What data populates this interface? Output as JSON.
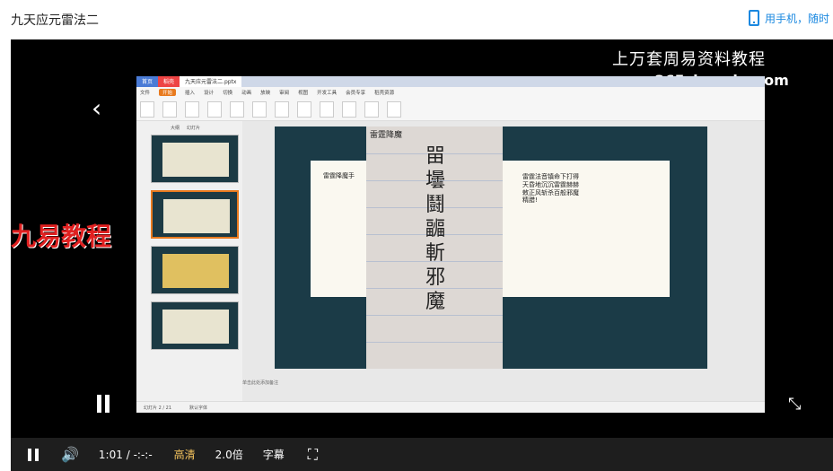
{
  "page": {
    "title": "九天应元雷法二",
    "phone_link": "用手机，随时"
  },
  "player": {
    "overlay_line1": "上万套周易资料教程",
    "overlay_line2": "www.265zhouyiw.com",
    "brand_watermark": "九易教程",
    "controls": {
      "time_current": "1:01",
      "time_separator": "/",
      "time_total": "-:-:-",
      "quality": "高清",
      "speed": "2.0倍",
      "subtitles": "字幕"
    }
  },
  "screen": {
    "tabs": [
      "首页",
      "稻壳",
      "九天应元雷法二.pptx"
    ],
    "menus": [
      "文件",
      "开始",
      "插入",
      "设计",
      "切换",
      "动画",
      "放映",
      "审阅",
      "视图",
      "开发工具",
      "会员专享",
      "稻壳资源"
    ],
    "thumb_tabs": [
      "大纲",
      "幻灯片"
    ],
    "slide": {
      "left_title": "雷霆降魔手",
      "right_text": "雷霆法音镇命下打得天昏地沉沉雷霆赫赫敕正风斩杀百般邪魔精腊!",
      "note_head": "雷霆降魔",
      "note_chars": "㽞壜鬪疈斬邪魔"
    },
    "status_left": "幻灯片 2 / 21",
    "status_theme": "默认字体",
    "remark": "单击此处添加备注"
  },
  "colors": {
    "accent": "#1a88e0",
    "brand_red": "#e02020",
    "quality": "#f5c45e"
  }
}
